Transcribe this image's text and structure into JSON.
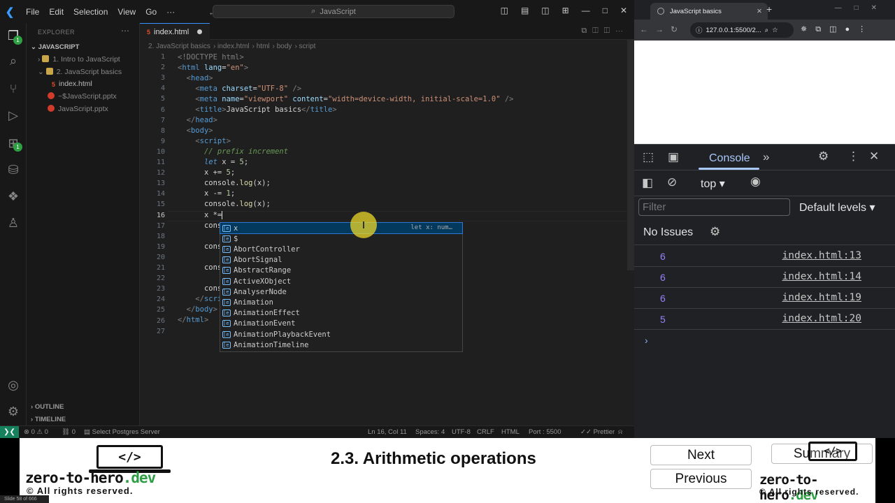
{
  "vscode": {
    "menu": [
      "File",
      "Edit",
      "Selection",
      "View",
      "Go",
      "···"
    ],
    "search": "JavaScript",
    "explorer": {
      "title": "EXPLORER",
      "root": "JAVASCRIPT",
      "items": [
        {
          "label": "1. Intro to JavaScript"
        },
        {
          "label": "2. JavaScript basics"
        },
        {
          "label": "index.html"
        },
        {
          "label": "~$JavaScript.pptx"
        },
        {
          "label": "JavaScript.pptx"
        }
      ],
      "outline": "OUTLINE",
      "timeline": "TIMELINE"
    },
    "tab": {
      "label": "index.html"
    },
    "breadcrumb": [
      "2. JavaScript basics",
      "index.html",
      "html",
      "body",
      "script"
    ],
    "line_numbers": [
      "1",
      "2",
      "3",
      "4",
      "5",
      "6",
      "7",
      "8",
      "9",
      "10",
      "11",
      "12",
      "13",
      "14",
      "15",
      "16",
      "17",
      "18",
      "19",
      "20",
      "21",
      "22",
      "23",
      "24",
      "25",
      "26",
      "27"
    ],
    "code": {
      "l1a": "<!DOCTYPE html>",
      "l2a": "<",
      "l2b": "html",
      "l2c": " lang",
      "l2d": "=",
      "l2e": "\"en\"",
      "l2f": ">",
      "l3": "head",
      "l4a": "meta",
      "l4b": " charset",
      "l4c": "\"UTF-8\"",
      "l5a": "meta",
      "l5b": " name",
      "l5c": "\"viewport\"",
      "l5d": " content",
      "l5e": "\"width=device-width, initial-scale=1.0\"",
      "l6a": "title",
      "l6b": "JavaScript basics",
      "l7": "head",
      "l8": "body",
      "l9": "script",
      "l10": "// prefix increment",
      "l11a": "let",
      "l11b": " x = ",
      "l11c": "5",
      "l12a": "x += ",
      "l12b": "5",
      "l13a": "console",
      "l13b": "log",
      "l13c": "x",
      "l14a": "x -= ",
      "l14b": "1",
      "l15a": "console",
      "l15b": "log",
      "l15c": "x",
      "l16": "x *=",
      "l17": "cons",
      "l19": "cons",
      "l21": "cons",
      "l22": "cons",
      "l23": "scri",
      "l24": "body",
      "l25": "html"
    },
    "suggest": {
      "items": [
        "x",
        "$",
        "AbortController",
        "AbortSignal",
        "AbstractRange",
        "ActiveXObject",
        "AnalyserNode",
        "Animation",
        "AnimationEffect",
        "AnimationEvent",
        "AnimationPlaybackEvent",
        "AnimationTimeline"
      ],
      "detail": "let x: num…"
    },
    "status": {
      "errors": "⊗ 0 ⚠ 0",
      "ports": "⛓ 0",
      "server": "Select Postgres Server",
      "cursor": "Ln 16, Col 11",
      "spaces": "Spaces: 4",
      "encoding": "UTF-8",
      "eol": "CRLF",
      "lang": "HTML",
      "port": "Port : 5500",
      "prettier": "Prettier"
    }
  },
  "browser": {
    "tab_title": "JavaScript basics",
    "url": "127.0.0.1:5500/2...",
    "devtools": {
      "panel": "Console",
      "context": "top",
      "filter_placeholder": "Filter",
      "levels": "Default levels",
      "issues": "No Issues",
      "logs": [
        {
          "value": "6",
          "source": "index.html:13"
        },
        {
          "value": "6",
          "source": "index.html:14"
        },
        {
          "value": "6",
          "source": "index.html:19"
        },
        {
          "value": "5",
          "source": "index.html:20"
        }
      ],
      "prompt": "›"
    }
  },
  "footer": {
    "logo_text": "</>",
    "brand_main": "zero-to-hero",
    "brand_tld": ".dev",
    "copyright": "© All rights reserved.",
    "title": "2.3. Arithmetic operations",
    "next": "Next",
    "summary": "Summary",
    "previous": "Previous",
    "slide": "Slide 58 of 666"
  },
  "colors": {
    "accent": "#3794ff",
    "remote": "#16825d",
    "console_value": "#9980ff",
    "brand_tld": "#2f9e44"
  }
}
